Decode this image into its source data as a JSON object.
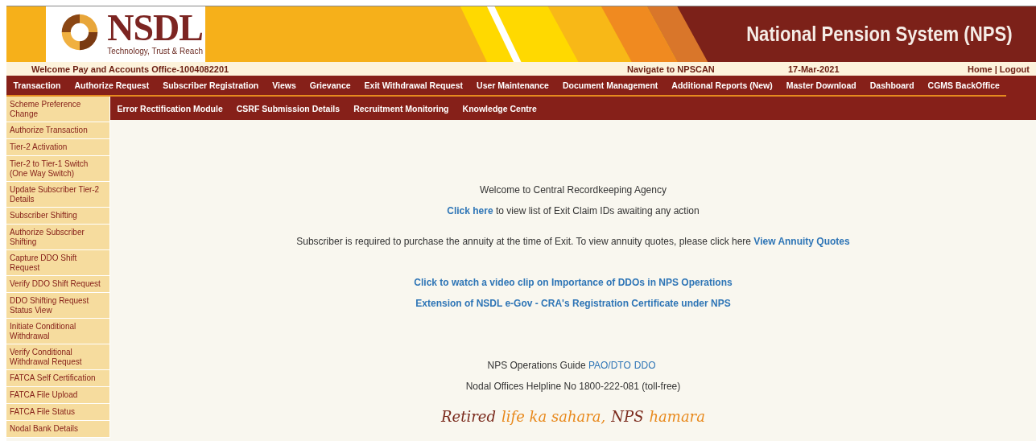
{
  "header": {
    "logo_name": "NSDL",
    "logo_tagline": "Technology, Trust & Reach",
    "title": "National Pension System (NPS)"
  },
  "info_bar": {
    "welcome": "Welcome Pay and Accounts Office-1004082201",
    "navigate": "Navigate to NPSCAN",
    "date": "17-Mar-2021",
    "links": [
      "Home",
      "Logout"
    ],
    "separator": "|"
  },
  "menu": [
    "Transaction",
    "Authorize Request",
    "Subscriber Registration",
    "Views",
    "Grievance",
    "Exit Withdrawal Request",
    "User Maintenance",
    "Document Management",
    "Additional Reports (New)",
    "Master Download",
    "Dashboard",
    "CGMS BackOffice"
  ],
  "submenu": [
    "Error Rectification Module",
    "CSRF Submission Details",
    "Recruitment Monitoring",
    "Knowledge Centre"
  ],
  "sidebar": {
    "items": [
      "Scheme Preference Change",
      "Authorize Transaction",
      "Tier-2 Activation",
      "Tier-2 to Tier-1 Switch (One Way Switch)",
      "Update Subscriber Tier-2 Details",
      "Subscriber Shifting",
      "Authorize Subscriber Shifting",
      "Capture DDO Shift Request",
      "Verify DDO Shift Request",
      "DDO Shifting Request Status View",
      "Initiate Conditional Withdrawal",
      "Verify Conditional Withdrawal Request",
      "FATCA Self Certification",
      "FATCA File Upload",
      "FATCA File Status",
      "Nodal Bank Details"
    ]
  },
  "content": {
    "groups": [
      [
        [
          {
            "kind": "text",
            "text": "Welcome to Central Recordkeeping Agency"
          }
        ],
        [
          {
            "kind": "link",
            "text": "Click here"
          },
          {
            "kind": "text",
            "text": " to view list of Exit Claim IDs awaiting any action"
          }
        ]
      ],
      [
        [
          {
            "kind": "text",
            "text": "Subscriber is required to purchase the annuity at the time of Exit. To view annuity quotes, please click here "
          },
          {
            "kind": "link",
            "text": "View Annuity Quotes"
          }
        ]
      ],
      [
        [
          {
            "kind": "link",
            "text": "Click to watch a video clip on Importance of DDOs in NPS Operations"
          }
        ],
        [
          {
            "kind": "link",
            "text": "Extension of NSDL e-Gov - CRA's Registration Certificate under NPS"
          }
        ]
      ],
      [
        [
          {
            "kind": "text",
            "text": "NPS Operations Guide "
          },
          {
            "kind": "plainlink",
            "text": "PAO/DTO"
          },
          {
            "kind": "plainlink",
            "text": "DDO"
          }
        ],
        [
          {
            "kind": "text",
            "text": "Nodal Offices Helpline No 1800-222-081 (toll-free)"
          }
        ]
      ]
    ],
    "slogan": [
      {
        "text": "Retired",
        "color": "#7a2a1c"
      },
      {
        "text": "life ka sahara,",
        "color": "#e8891c"
      },
      {
        "text": "NPS",
        "color": "#7a2a1c"
      },
      {
        "text": "hamara",
        "color": "#e8891c"
      }
    ]
  }
}
